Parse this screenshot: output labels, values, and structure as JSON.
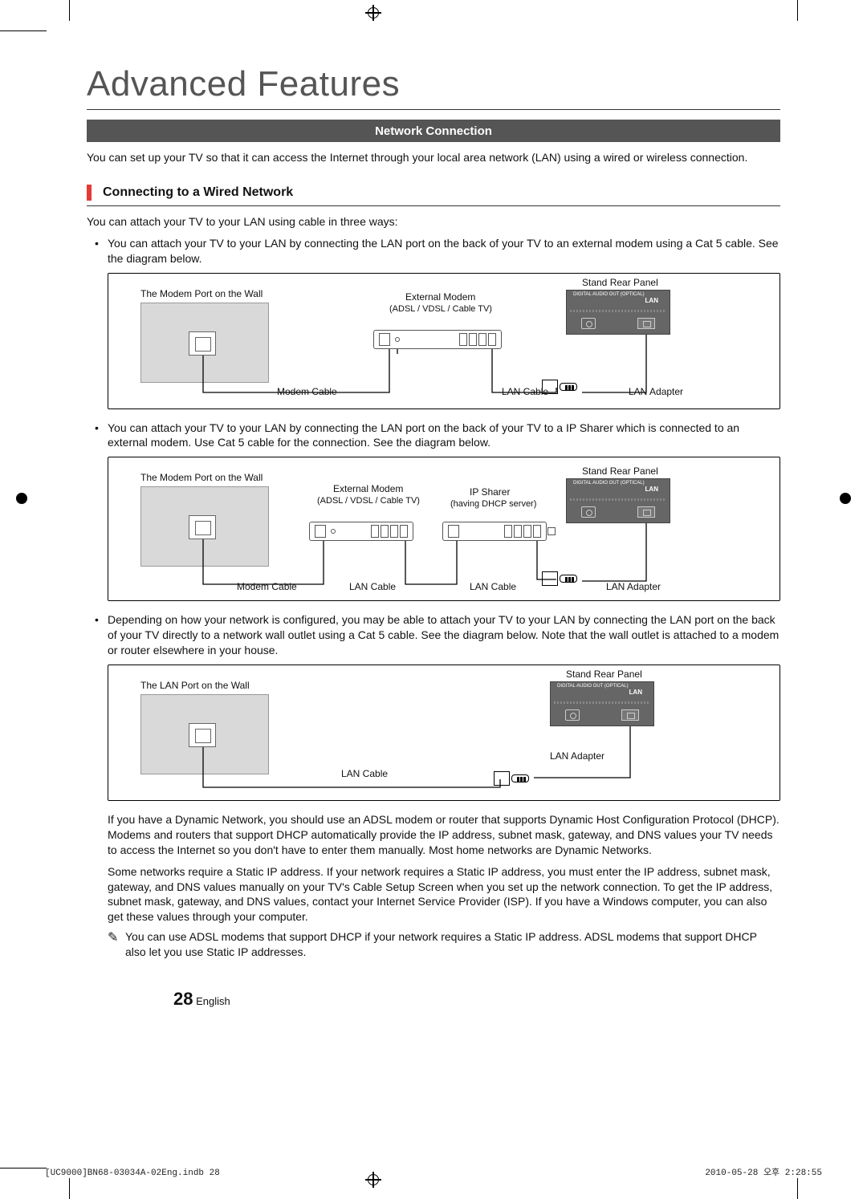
{
  "page": {
    "title": "Advanced Features",
    "section_bar": "Network Connection",
    "intro": "You can set up your TV so that it can access the Internet through your local area network (LAN) using a wired or wireless connection.",
    "subheading": "Connecting to a Wired Network",
    "lead": "You can attach your TV to your LAN using cable in three ways:",
    "bullets": [
      "You can attach your TV to your LAN by connecting the LAN port on the back of your TV to an external modem using a Cat 5 cable. See the diagram below.",
      "You can attach your TV to your LAN by connecting the LAN port on the back of your TV to a IP Sharer which is connected to an external modem. Use Cat 5 cable for the connection. See the diagram below.",
      "Depending on how your network is configured, you may be able to attach your TV to your LAN by connecting the LAN port on the back of your TV directly to a network wall outlet using a Cat 5 cable. See the diagram below. Note that the wall outlet is attached to a modem or router elsewhere in your house."
    ],
    "diagrams": {
      "common": {
        "wall_port": "The Modem Port on the Wall",
        "wall_port_lan": "The LAN Port on the Wall",
        "stand_panel": "Stand Rear Panel",
        "modem": "External Modem",
        "modem_sub": "(ADSL / VDSL / Cable TV)",
        "sharer": "IP Sharer",
        "sharer_sub": "(having DHCP server)",
        "modem_cable": "Modem Cable",
        "lan_cable": "LAN Cable",
        "lan_adapter": "LAN Adapter",
        "panel_optical": "DIGITAL\nAUDIO OUT\n(OPTICAL)",
        "panel_lan": "LAN"
      }
    },
    "paras": [
      "If you have a Dynamic Network, you should use an ADSL modem or router that supports Dynamic Host Configuration Protocol (DHCP). Modems and routers that support DHCP automatically provide the IP address, subnet mask, gateway, and DNS values your TV needs to access the Internet so you don't have to enter them manually. Most home networks are Dynamic Networks.",
      "Some networks require a Static IP address. If your network requires a Static IP address, you must enter the IP address, subnet mask, gateway, and DNS values manually on your TV's Cable Setup Screen when you set up the network connection. To get the IP address, subnet mask, gateway, and DNS values, contact your Internet Service Provider (ISP). If you have a Windows computer, you can also get these values through your computer."
    ],
    "note": "You can use ADSL modems that support DHCP if your network requires a Static IP address. ADSL modems that support DHCP also let you use Static IP addresses.",
    "page_number": "28",
    "page_lang": "English"
  },
  "slug": {
    "left": "[UC9000]BN68-03034A-02Eng.indb   28",
    "right": "2010-05-28   오후 2:28:55"
  }
}
